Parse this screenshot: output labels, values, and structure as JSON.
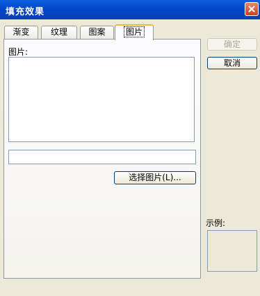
{
  "window": {
    "title": "填充效果",
    "close_icon": "close-icon"
  },
  "tabs": [
    {
      "label": "渐变",
      "active": false
    },
    {
      "label": "纹理",
      "active": false
    },
    {
      "label": "图案",
      "active": false
    },
    {
      "label": "图片",
      "active": true
    }
  ],
  "picture_panel": {
    "label": "图片:",
    "path_value": "",
    "select_button_label": "选择图片(L)..."
  },
  "buttons": {
    "ok_label": "确定",
    "ok_enabled": false,
    "cancel_label": "取消"
  },
  "sample": {
    "label": "示例:"
  },
  "colors": {
    "title_bar": "#0346c8",
    "dialog_bg": "#ece9d8",
    "active_tab_accent": "#f3b33c",
    "input_border": "#7f9db9"
  }
}
